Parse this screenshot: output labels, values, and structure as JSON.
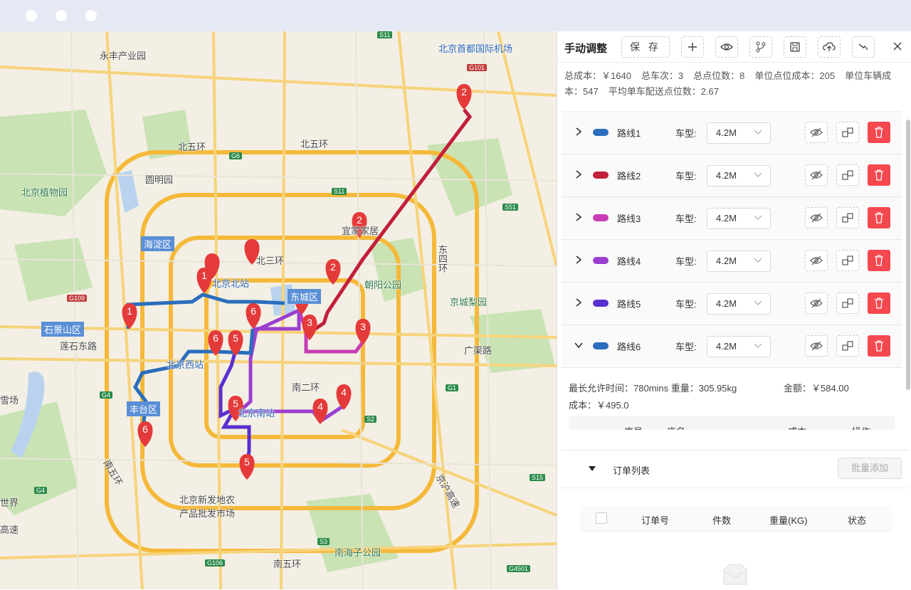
{
  "window": {
    "dots": 3
  },
  "map": {
    "labels": {
      "yongfeng": "永丰产业园",
      "airport": "北京首都国际机场",
      "beiwuhuan_w": "北五环",
      "beiwuhuan_e": "北五环",
      "yuanmingyuan": "圆明园",
      "zhiwuyuan": "北京植物园",
      "haidian": "海淀区",
      "beisanhuan": "北三环",
      "beijingbei": "北京北站",
      "yijiajuyi": "宜家家居",
      "chaoyang_park": "朝阳公园",
      "dongsihuan": "东四环",
      "jingchengliyuan": "京城梨园",
      "shijingshan": "石景山区",
      "lianshi": "莲石东路",
      "dongcheng": "东城区",
      "guangqu": "广渠路",
      "beijingxi": "北京西站",
      "nanerhuan": "南二环",
      "beijingnan": "北京南站",
      "fengtai": "丰台区",
      "xuechang": "雪场",
      "nanwuhuan_w": "南五环",
      "xinfadi": "北京新发地农\n产品批发市场",
      "jinghu": "京沪高速",
      "shijie": "世界",
      "gaosu": "高速",
      "nanwuhuan_s": "南五环",
      "nanhaizi": "南海子公园"
    },
    "roadtags": [
      "S11",
      "G101",
      "S11",
      "S51",
      "G109",
      "G4",
      "G1",
      "S2",
      "S15",
      "G4",
      "G106",
      "S3",
      "G4501",
      "G6"
    ]
  },
  "panel": {
    "title": "手动调整",
    "save_label": "保 存",
    "summary": {
      "total_cost": "总成本：￥1640",
      "total_trips": "总车次：3",
      "total_points": "总点位数：8",
      "unit_point_cost": "单位点位成本：205",
      "unit_vehicle_cost": "单位车辆成本：547",
      "avg_points": "平均单车配送点位数：2.67"
    },
    "vehicle_label": "车型:",
    "routes": [
      {
        "name": "路线1",
        "color": "#2a6ebd",
        "vehicle": "4.2M",
        "expanded": false
      },
      {
        "name": "路线2",
        "color": "#c21f3a",
        "vehicle": "4.2M",
        "expanded": false
      },
      {
        "name": "路线3",
        "color": "#c83cb4",
        "vehicle": "4.2M",
        "expanded": false
      },
      {
        "name": "路线4",
        "color": "#9b3fcf",
        "vehicle": "4.2M",
        "expanded": false
      },
      {
        "name": "路线5",
        "color": "#5a2fd0",
        "vehicle": "4.2M",
        "expanded": false
      },
      {
        "name": "路线6",
        "color": "#2a6ebd",
        "vehicle": "4.2M",
        "expanded": true
      }
    ],
    "detail": {
      "limits": "最长允许时间：780mins 重量：305.95kg",
      "amount": "金额：￥584.00",
      "cost": "成本：￥495.0",
      "columns": [
        "序号",
        "店名",
        "成本",
        "操作"
      ]
    },
    "orders": {
      "title": "订单列表",
      "batch_add": "批量添加",
      "columns": [
        "订单号",
        "件数",
        "重量(KG)",
        "状态"
      ]
    }
  }
}
